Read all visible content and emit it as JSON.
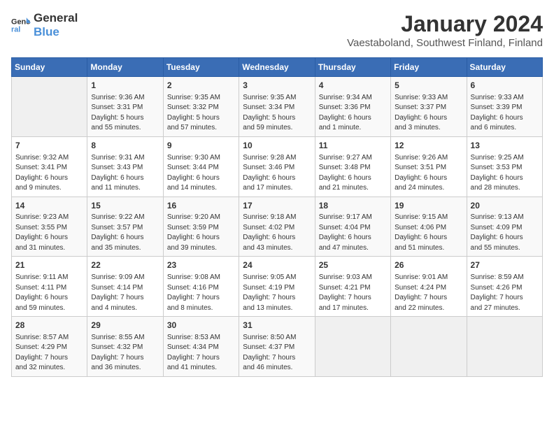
{
  "logo": {
    "line1": "General",
    "line2": "Blue"
  },
  "title": "January 2024",
  "location": "Vaestaboland, Southwest Finland, Finland",
  "days_of_week": [
    "Sunday",
    "Monday",
    "Tuesday",
    "Wednesday",
    "Thursday",
    "Friday",
    "Saturday"
  ],
  "weeks": [
    [
      {
        "day": "",
        "info": ""
      },
      {
        "day": "1",
        "info": "Sunrise: 9:36 AM\nSunset: 3:31 PM\nDaylight: 5 hours\nand 55 minutes."
      },
      {
        "day": "2",
        "info": "Sunrise: 9:35 AM\nSunset: 3:32 PM\nDaylight: 5 hours\nand 57 minutes."
      },
      {
        "day": "3",
        "info": "Sunrise: 9:35 AM\nSunset: 3:34 PM\nDaylight: 5 hours\nand 59 minutes."
      },
      {
        "day": "4",
        "info": "Sunrise: 9:34 AM\nSunset: 3:36 PM\nDaylight: 6 hours\nand 1 minute."
      },
      {
        "day": "5",
        "info": "Sunrise: 9:33 AM\nSunset: 3:37 PM\nDaylight: 6 hours\nand 3 minutes."
      },
      {
        "day": "6",
        "info": "Sunrise: 9:33 AM\nSunset: 3:39 PM\nDaylight: 6 hours\nand 6 minutes."
      }
    ],
    [
      {
        "day": "7",
        "info": "Sunrise: 9:32 AM\nSunset: 3:41 PM\nDaylight: 6 hours\nand 9 minutes."
      },
      {
        "day": "8",
        "info": "Sunrise: 9:31 AM\nSunset: 3:43 PM\nDaylight: 6 hours\nand 11 minutes."
      },
      {
        "day": "9",
        "info": "Sunrise: 9:30 AM\nSunset: 3:44 PM\nDaylight: 6 hours\nand 14 minutes."
      },
      {
        "day": "10",
        "info": "Sunrise: 9:28 AM\nSunset: 3:46 PM\nDaylight: 6 hours\nand 17 minutes."
      },
      {
        "day": "11",
        "info": "Sunrise: 9:27 AM\nSunset: 3:48 PM\nDaylight: 6 hours\nand 21 minutes."
      },
      {
        "day": "12",
        "info": "Sunrise: 9:26 AM\nSunset: 3:51 PM\nDaylight: 6 hours\nand 24 minutes."
      },
      {
        "day": "13",
        "info": "Sunrise: 9:25 AM\nSunset: 3:53 PM\nDaylight: 6 hours\nand 28 minutes."
      }
    ],
    [
      {
        "day": "14",
        "info": "Sunrise: 9:23 AM\nSunset: 3:55 PM\nDaylight: 6 hours\nand 31 minutes."
      },
      {
        "day": "15",
        "info": "Sunrise: 9:22 AM\nSunset: 3:57 PM\nDaylight: 6 hours\nand 35 minutes."
      },
      {
        "day": "16",
        "info": "Sunrise: 9:20 AM\nSunset: 3:59 PM\nDaylight: 6 hours\nand 39 minutes."
      },
      {
        "day": "17",
        "info": "Sunrise: 9:18 AM\nSunset: 4:02 PM\nDaylight: 6 hours\nand 43 minutes."
      },
      {
        "day": "18",
        "info": "Sunrise: 9:17 AM\nSunset: 4:04 PM\nDaylight: 6 hours\nand 47 minutes."
      },
      {
        "day": "19",
        "info": "Sunrise: 9:15 AM\nSunset: 4:06 PM\nDaylight: 6 hours\nand 51 minutes."
      },
      {
        "day": "20",
        "info": "Sunrise: 9:13 AM\nSunset: 4:09 PM\nDaylight: 6 hours\nand 55 minutes."
      }
    ],
    [
      {
        "day": "21",
        "info": "Sunrise: 9:11 AM\nSunset: 4:11 PM\nDaylight: 6 hours\nand 59 minutes."
      },
      {
        "day": "22",
        "info": "Sunrise: 9:09 AM\nSunset: 4:14 PM\nDaylight: 7 hours\nand 4 minutes."
      },
      {
        "day": "23",
        "info": "Sunrise: 9:08 AM\nSunset: 4:16 PM\nDaylight: 7 hours\nand 8 minutes."
      },
      {
        "day": "24",
        "info": "Sunrise: 9:05 AM\nSunset: 4:19 PM\nDaylight: 7 hours\nand 13 minutes."
      },
      {
        "day": "25",
        "info": "Sunrise: 9:03 AM\nSunset: 4:21 PM\nDaylight: 7 hours\nand 17 minutes."
      },
      {
        "day": "26",
        "info": "Sunrise: 9:01 AM\nSunset: 4:24 PM\nDaylight: 7 hours\nand 22 minutes."
      },
      {
        "day": "27",
        "info": "Sunrise: 8:59 AM\nSunset: 4:26 PM\nDaylight: 7 hours\nand 27 minutes."
      }
    ],
    [
      {
        "day": "28",
        "info": "Sunrise: 8:57 AM\nSunset: 4:29 PM\nDaylight: 7 hours\nand 32 minutes."
      },
      {
        "day": "29",
        "info": "Sunrise: 8:55 AM\nSunset: 4:32 PM\nDaylight: 7 hours\nand 36 minutes."
      },
      {
        "day": "30",
        "info": "Sunrise: 8:53 AM\nSunset: 4:34 PM\nDaylight: 7 hours\nand 41 minutes."
      },
      {
        "day": "31",
        "info": "Sunrise: 8:50 AM\nSunset: 4:37 PM\nDaylight: 7 hours\nand 46 minutes."
      },
      {
        "day": "",
        "info": ""
      },
      {
        "day": "",
        "info": ""
      },
      {
        "day": "",
        "info": ""
      }
    ]
  ]
}
